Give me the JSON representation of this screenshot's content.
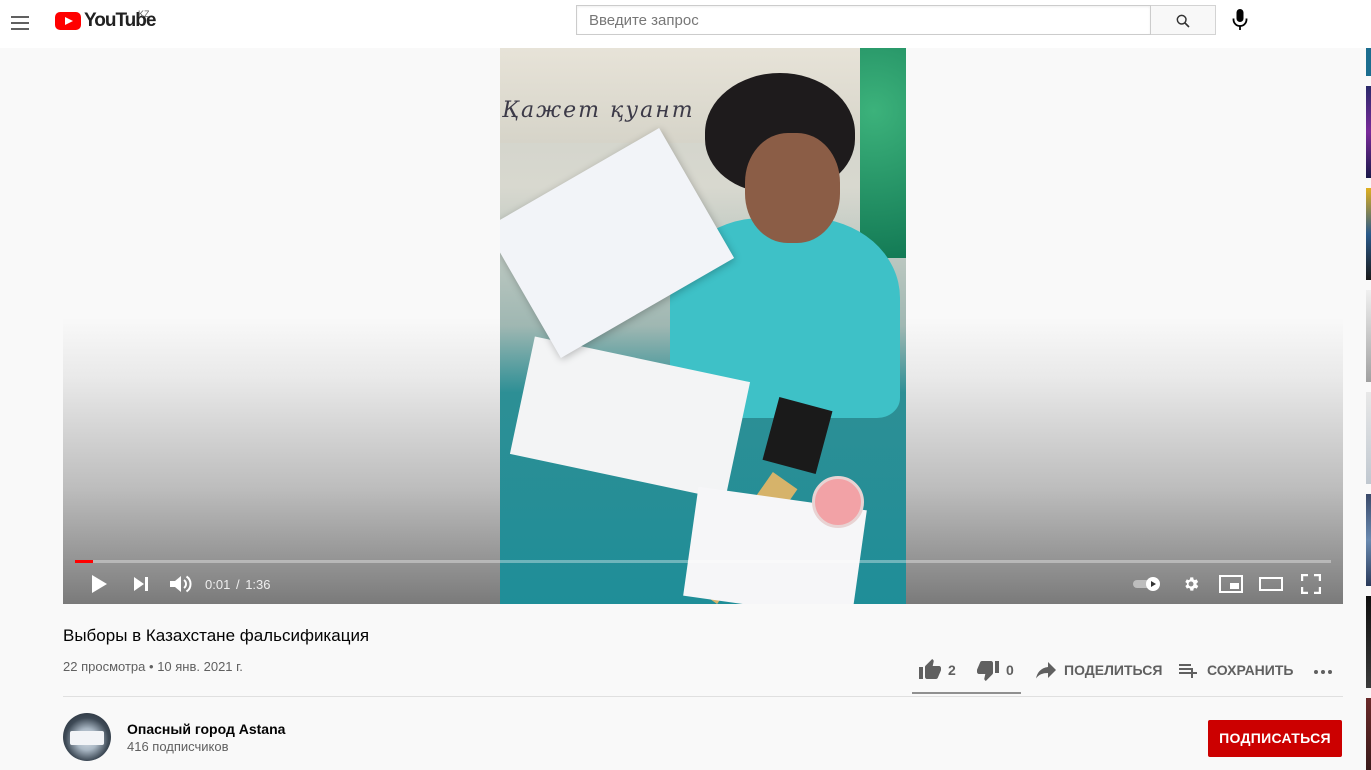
{
  "masthead": {
    "logo_text": "YouTube",
    "region": "KZ",
    "search_placeholder": "Введите запрос",
    "search_value": ""
  },
  "player": {
    "banner_text": "Қажет қуант",
    "progress_fraction": 0.0104,
    "current_time": "0:01",
    "separator": "/",
    "duration": "1:36"
  },
  "video": {
    "title": "Выборы в Казахстане фальсификация",
    "views": "22 просмотра",
    "meta_sep": "•",
    "date": "10 янв. 2021 г.",
    "likes": "2",
    "dislikes": "0",
    "share_label": "ПОДЕЛИТЬСЯ",
    "save_label": "СОХРАНИТЬ"
  },
  "channel": {
    "name": "Опасный город Astana",
    "subscribers": "416 подписчиков",
    "subscribe_label": "ПОДПИСАТЬСЯ"
  },
  "colors": {
    "brand_red": "#ff0000",
    "subscribe_red": "#cc0000",
    "text_secondary": "#606060"
  },
  "icons": [
    "menu-icon",
    "youtube-logo-icon",
    "search-icon",
    "mic-icon",
    "play-icon",
    "next-icon",
    "volume-icon",
    "autoplay-toggle-icon",
    "settings-gear-icon",
    "miniplayer-icon",
    "theater-mode-icon",
    "fullscreen-icon",
    "thumbs-up-icon",
    "thumbs-down-icon",
    "share-icon",
    "save-playlist-icon",
    "more-icon"
  ]
}
